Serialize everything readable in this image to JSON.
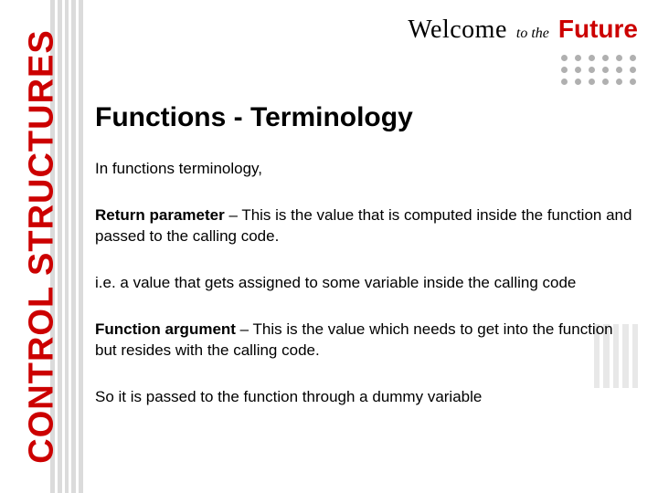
{
  "sidebar": {
    "label": "CONTROL STRUCTURES"
  },
  "header": {
    "welcome": "Welcome",
    "tothe": "to the",
    "future": "Future"
  },
  "title": "Functions - Terminology",
  "body": {
    "intro": "In functions terminology,",
    "p1_bold": "Return parameter",
    "p1_rest": " – This is the value that is computed inside the function and passed to the calling code.",
    "p2": "i.e. a value that gets assigned to some variable inside the calling code",
    "p3_bold": "Function argument",
    "p3_rest": " – This is the value which needs to get into the function but resides with the calling code.",
    "p4": "So it is passed to the function through a dummy variable"
  }
}
